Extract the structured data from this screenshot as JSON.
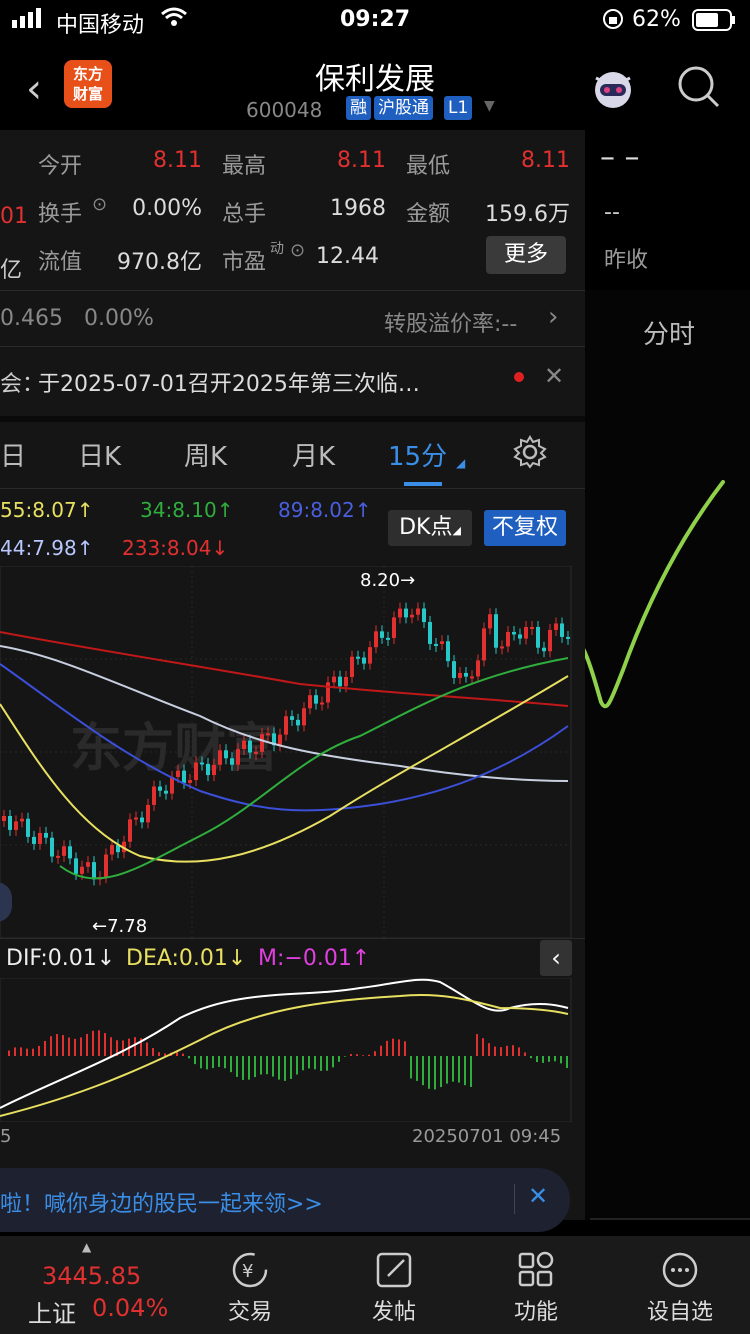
{
  "status": {
    "carrier": "中国移动",
    "time": "09:27",
    "battery": "62%"
  },
  "header": {
    "title": "保利发展",
    "code": "600048",
    "tags": [
      "融",
      "沪股通",
      "L1"
    ],
    "logo_line1": "东方",
    "logo_line2": "财富"
  },
  "quote": {
    "open_label": "今开",
    "open": "8.11",
    "high_label": "最高",
    "high": "8.11",
    "low_label": "最低",
    "low": "8.11",
    "turnover_label": "换手",
    "turnover": "0.00%",
    "volume_label": "总手",
    "volume": "1968",
    "amount_label": "金额",
    "amount": "159.6万",
    "float_label": "流值",
    "float_value": "970.8亿",
    "pe_label": "市盈",
    "pe_sup": "动",
    "pe": "12.44",
    "more": "更多",
    "left_edge1": "01",
    "left_edge2": "亿",
    "right_dash1": "--",
    "right_dash2": "--",
    "prev_close_label": "昨收"
  },
  "convert": {
    "left": "0.465   0.00%",
    "label": "转股溢价率:--"
  },
  "notice": {
    "prefix": "会：",
    "text": "于2025-07-01召开2025年第三次临…"
  },
  "tabs": [
    "日",
    "日K",
    "周K",
    "月K",
    "15分"
  ],
  "minute_tab": "分时",
  "ma": {
    "ma55": "55:8.07↑",
    "ma34": "34:8.10↑",
    "ma89": "89:8.02↑",
    "ma144": "44:7.98↑",
    "ma233": "233:8.04↓",
    "dk": "DK点",
    "fq": "不复权"
  },
  "chart_labels": {
    "high": "8.20→",
    "low": "←7.78",
    "watermark": "东方财富"
  },
  "macd": {
    "dif": "DIF:0.01↓",
    "dea": "DEA:0.01↓",
    "m": "M:−0.01↑"
  },
  "time_axis": {
    "left": "5",
    "right": "20250701 09:45"
  },
  "banner": {
    "text": "啦！喊你身边的股民一起来领>>"
  },
  "bottom": {
    "index_value": "3445.85",
    "index_name": "上证",
    "index_change": "0.04%",
    "nav": [
      "交易",
      "发帖",
      "功能",
      "设自选"
    ]
  },
  "colors": {
    "up": "#e03030",
    "down": "#28c8c8",
    "ma_yellow": "#e8e060",
    "ma_green": "#2fae3e",
    "ma_blue": "#3b4fd8",
    "ma_red": "#c01818",
    "ma_white": "#c8cfe0"
  }
}
